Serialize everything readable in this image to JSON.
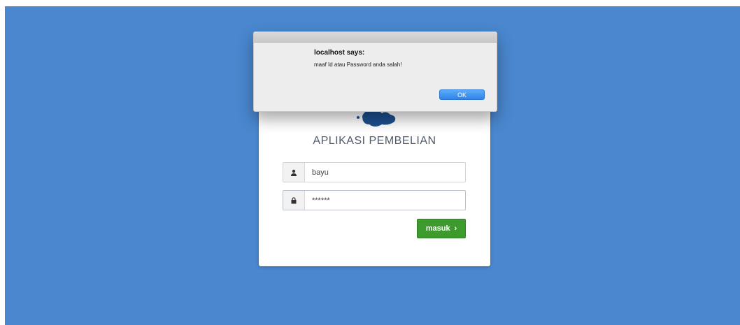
{
  "app": {
    "title": "APLIKASI PEMBELIAN"
  },
  "login": {
    "username_value": "bayu",
    "password_value": "******",
    "submit_label": "masuk",
    "submit_chevron": "›",
    "user_icon": "user-icon",
    "lock_icon": "lock-icon"
  },
  "dialog": {
    "title": "localhost says:",
    "message": "maaf Id atau Password anda salah!",
    "ok_label": "OK"
  },
  "colors": {
    "background": "#4a87cf",
    "submit_button": "#3d9a2c",
    "ok_button": "#2f84ea"
  }
}
